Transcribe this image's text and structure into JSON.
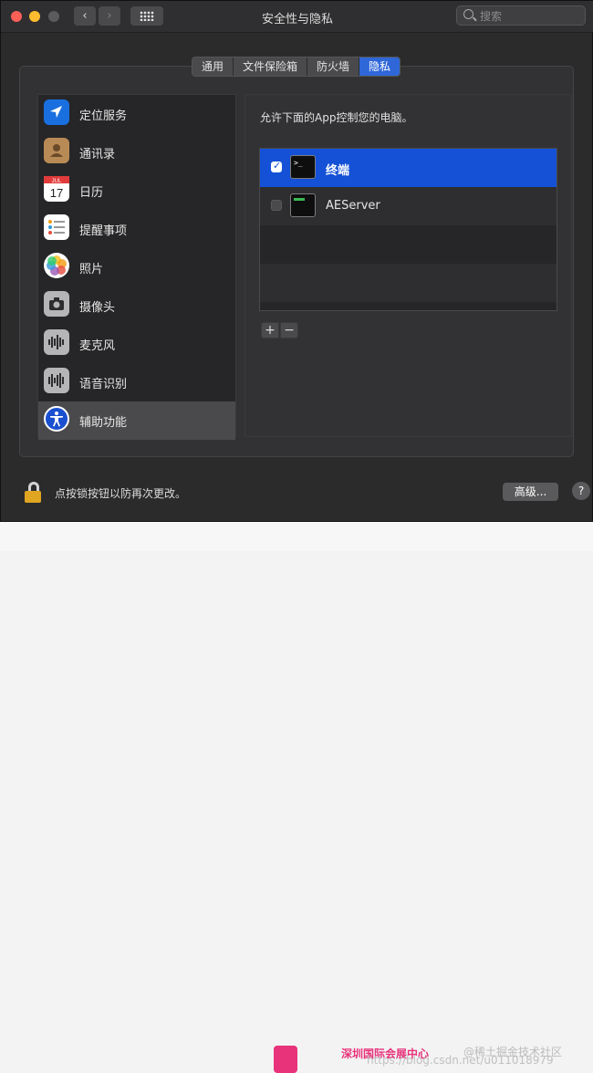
{
  "window": {
    "title": "安全性与隐私"
  },
  "toolbar": {
    "back_glyph": "‹",
    "forward_glyph": "›",
    "search_placeholder": "搜索"
  },
  "tabs": [
    {
      "label": "通用",
      "active": false
    },
    {
      "label": "文件保险箱",
      "active": false
    },
    {
      "label": "防火墙",
      "active": false
    },
    {
      "label": "隐私",
      "active": true
    }
  ],
  "sidebar": {
    "items": [
      {
        "label": "定位服务",
        "icon": "location-icon"
      },
      {
        "label": "通讯录",
        "icon": "contacts-icon"
      },
      {
        "label": "日历",
        "icon": "calendar-icon"
      },
      {
        "label": "提醒事项",
        "icon": "reminders-icon"
      },
      {
        "label": "照片",
        "icon": "photos-icon"
      },
      {
        "label": "摄像头",
        "icon": "camera-icon"
      },
      {
        "label": "麦克风",
        "icon": "microphone-icon"
      },
      {
        "label": "语音识别",
        "icon": "speech-recognition-icon"
      },
      {
        "label": "辅助功能",
        "icon": "accessibility-icon",
        "selected": true
      }
    ],
    "calendar_icon": {
      "month": "JUL",
      "day": "17"
    }
  },
  "main": {
    "description": "允许下面的App控制您的电脑。",
    "apps": [
      {
        "name": "终端",
        "checked": true,
        "selected": true,
        "icon": "terminal-icon",
        "icon_text": ">_"
      },
      {
        "name": "AEServer",
        "checked": false,
        "selected": false,
        "icon": "app-icon"
      }
    ],
    "add_label": "+",
    "remove_label": "−"
  },
  "footer": {
    "lock_text": "点按锁按钮以防再次更改。",
    "advanced_label": "高级...",
    "help_label": "?"
  },
  "banner": {
    "org_text": "深圳国际会展中心",
    "watermark": "https://blog.csdn.net/u011018979",
    "watermark2": "@稀土掘金技术社区"
  },
  "colors": {
    "accent": "#2f67d8",
    "selection": "#1451d6",
    "lock": "#e0a521"
  }
}
